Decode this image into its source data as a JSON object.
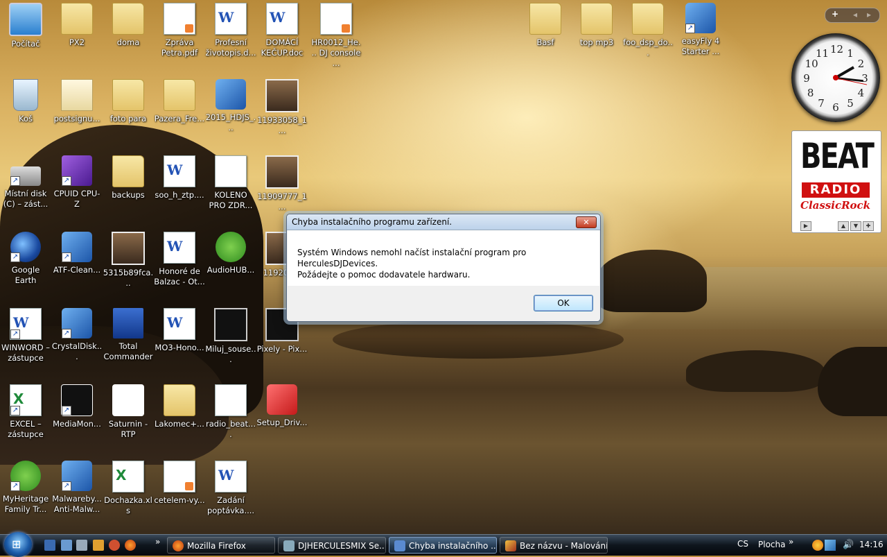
{
  "desktop": {
    "icons": [
      {
        "label": "Počítač"
      },
      {
        "label": "PX2"
      },
      {
        "label": "doma"
      },
      {
        "label": "Zpráva Petra.pdf"
      },
      {
        "label": "Profesní životopis.d..."
      },
      {
        "label": "DOMÁCÍ KEČUP.doc"
      },
      {
        "label": "HR0012_He... DJ console ..."
      },
      {
        "label": "Basf"
      },
      {
        "label": "top mp3"
      },
      {
        "label": "foo_dsp_do..."
      },
      {
        "label": "easyFly 4 Starter ..."
      },
      {
        "label": "Koš"
      },
      {
        "label": "postsignu..."
      },
      {
        "label": "foto para"
      },
      {
        "label": "Pazera_Fre..."
      },
      {
        "label": "2015_HDJS_..."
      },
      {
        "label": "11933058_1..."
      },
      {
        "label": "Místní disk (C) – zást..."
      },
      {
        "label": "CPUID CPU-Z"
      },
      {
        "label": "backups"
      },
      {
        "label": "soo_h_ztp...."
      },
      {
        "label": "KOLENO PRO ZDR..."
      },
      {
        "label": "11909777_1..."
      },
      {
        "label": "Google Earth"
      },
      {
        "label": "ATF-Clean..."
      },
      {
        "label": "5315b89fca..."
      },
      {
        "label": "Honoré de Balzac - Ot..."
      },
      {
        "label": "AudioHUB..."
      },
      {
        "label": "119205..."
      },
      {
        "label": "WINWORD – zástupce"
      },
      {
        "label": "CrystalDisk..."
      },
      {
        "label": "Total Commander"
      },
      {
        "label": "MO3-Hono..."
      },
      {
        "label": "Miluj_souse..."
      },
      {
        "label": "Pixely - Pix..."
      },
      {
        "label": "EXCEL – zástupce"
      },
      {
        "label": "MediaMon..."
      },
      {
        "label": "Saturnin - RTP"
      },
      {
        "label": "Lakomec+..."
      },
      {
        "label": "radio_beat...."
      },
      {
        "label": "Setup_Driv..."
      },
      {
        "label": "MyHeritage Family Tr..."
      },
      {
        "label": "Malwareby... Anti-Malw..."
      },
      {
        "label": "Dochazka.xls"
      },
      {
        "label": "cetelem-vy..."
      },
      {
        "label": "Zadání poptávka...."
      }
    ]
  },
  "gadgets": {
    "clock": {
      "numbers": [
        "12",
        "1",
        "2",
        "3",
        "4",
        "5",
        "6",
        "7",
        "8",
        "9",
        "10",
        "11"
      ]
    },
    "radio": {
      "line1": "BEAT",
      "line2": "RADIO",
      "line3": "ClassicRock"
    }
  },
  "dialog": {
    "title": "Chyba instalačního programu zařízení.",
    "line1": "Systém Windows nemohl načíst instalační program pro HerculesDJDevices.",
    "line2": "Požádejte o pomoc dodavatele hardwaru.",
    "ok_label": "OK",
    "close_label": "✕"
  },
  "taskbar": {
    "tasks": [
      {
        "label": "Mozilla Firefox"
      },
      {
        "label": "DJHERCULESMIX Se..."
      },
      {
        "label": "Chyba instalačního ..."
      },
      {
        "label": "Bez názvu - Malování"
      }
    ],
    "language": "CS",
    "desktop_label": "Plocha",
    "time": "14:16",
    "overflow": "»"
  }
}
